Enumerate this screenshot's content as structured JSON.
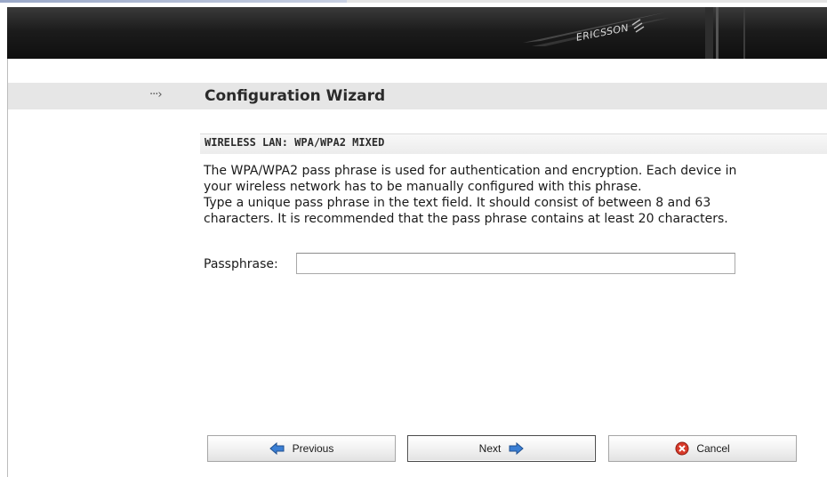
{
  "header": {
    "brand": "ERICSSON"
  },
  "wizard": {
    "arrow_glyph": "···›",
    "title": "Configuration Wizard"
  },
  "section": {
    "title": "WIRELESS LAN: WPA/WPA2 MIXED",
    "lines": [
      "The WPA/WPA2 pass phrase is used for authentication and encryption. Each device in",
      "your wireless network has to be manually configured with this phrase.",
      "Type a unique pass phrase in the text field. It should consist of between 8 and 63",
      "characters. It is recommended that the pass phrase contains at least 20 characters."
    ]
  },
  "form": {
    "passphrase_label": "Passphrase:",
    "passphrase_value": ""
  },
  "buttons": {
    "previous": "Previous",
    "next": "Next",
    "cancel": "Cancel"
  },
  "colors": {
    "arrow_icon": "#3b7fd4",
    "cancel_icon": "#d83a2a",
    "header_dark": "#1c1c1c",
    "title_strip": "#e6e6e6"
  },
  "icons": {
    "previous": "left-arrow-icon",
    "next": "right-arrow-icon",
    "cancel": "cancel-x-icon"
  }
}
